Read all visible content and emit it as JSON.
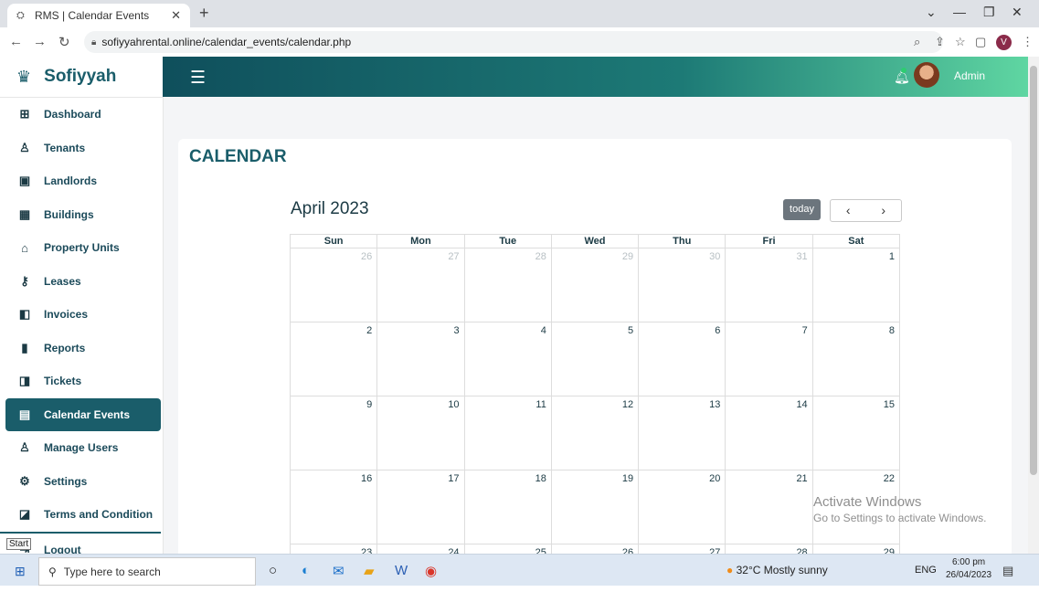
{
  "browser": {
    "tab_title": "RMS | Calendar Events",
    "url": "sofiyyahrental.online/calendar_events/calendar.php"
  },
  "app": {
    "brand": "Sofiyyah",
    "user_name": "Admin",
    "accent_color": "#1a5d6a"
  },
  "sidebar": {
    "items": [
      {
        "label": "Dashboard",
        "icon": "grid-icon"
      },
      {
        "label": "Tenants",
        "icon": "person-icon"
      },
      {
        "label": "Landlords",
        "icon": "id-card-icon"
      },
      {
        "label": "Buildings",
        "icon": "building-icon"
      },
      {
        "label": "Property Units",
        "icon": "house-icon"
      },
      {
        "label": "Leases",
        "icon": "key-icon"
      },
      {
        "label": "Invoices",
        "icon": "invoice-icon"
      },
      {
        "label": "Reports",
        "icon": "bar-chart-icon"
      },
      {
        "label": "Tickets",
        "icon": "ticket-icon"
      },
      {
        "label": "Calendar Events",
        "icon": "calendar-icon"
      },
      {
        "label": "Manage Users",
        "icon": "add-user-icon"
      },
      {
        "label": "Settings",
        "icon": "gear-icon"
      },
      {
        "label": "Terms and Condition",
        "icon": "book-icon"
      },
      {
        "label": "Logout",
        "icon": "logout-icon"
      }
    ],
    "active": "Calendar Events"
  },
  "page": {
    "title": "CALENDAR"
  },
  "calendar": {
    "month_label": "April 2023",
    "today_label": "today",
    "prev_label": "‹",
    "next_label": "›",
    "weekdays": [
      "Sun",
      "Mon",
      "Tue",
      "Wed",
      "Thu",
      "Fri",
      "Sat"
    ],
    "weeks": [
      [
        "26",
        "27",
        "28",
        "29",
        "30",
        "31",
        "1"
      ],
      [
        "2",
        "3",
        "4",
        "5",
        "6",
        "7",
        "8"
      ],
      [
        "9",
        "10",
        "11",
        "12",
        "13",
        "14",
        "15"
      ],
      [
        "16",
        "17",
        "18",
        "19",
        "20",
        "21",
        "22"
      ],
      [
        "23",
        "24",
        "25",
        "26",
        "27",
        "28",
        "29"
      ]
    ]
  },
  "overlay": {
    "activate_title": "Activate Windows",
    "activate_sub": "Go to Settings to activate Windows.",
    "start_tooltip": "Start"
  },
  "taskbar": {
    "search_placeholder": "Type here to search",
    "weather": "32°C  Mostly sunny",
    "lang": "ENG",
    "time": "6:00 pm",
    "date": "26/04/2023",
    "notif_count": "6"
  }
}
